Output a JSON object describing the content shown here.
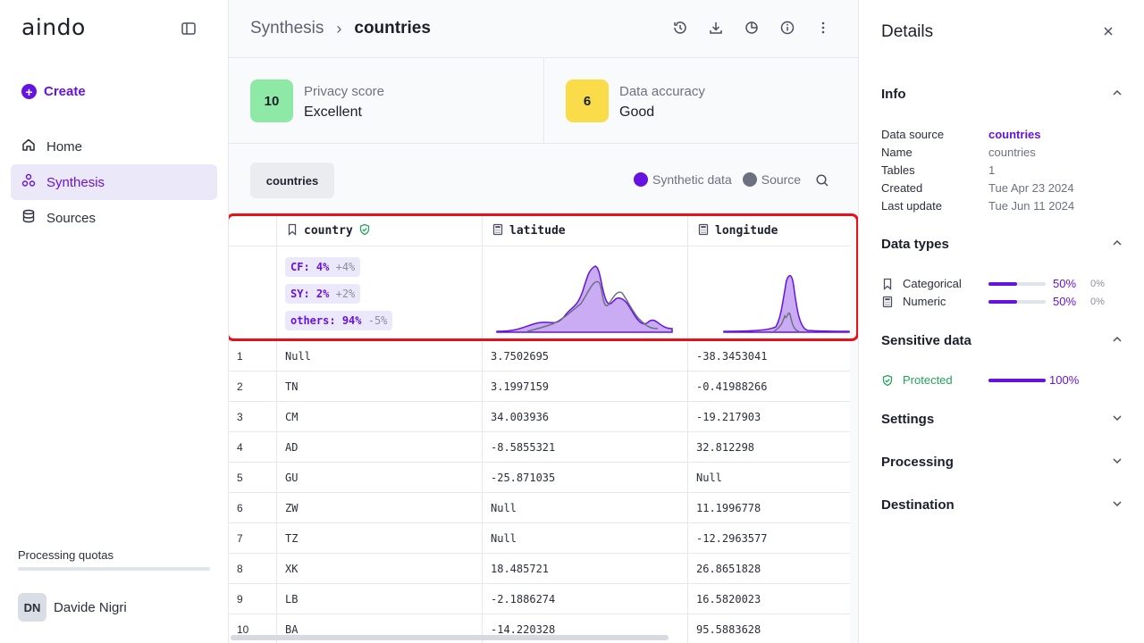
{
  "sidebar": {
    "logo": "aindo",
    "create_label": "Create",
    "nav": [
      {
        "label": "Home",
        "icon": "home-icon"
      },
      {
        "label": "Synthesis",
        "icon": "synthesis-icon"
      },
      {
        "label": "Sources",
        "icon": "database-icon"
      }
    ],
    "quota_label": "Processing quotas",
    "user": {
      "initials": "DN",
      "name": "Davide Nigri"
    }
  },
  "header": {
    "breadcrumb_parent": "Synthesis",
    "breadcrumb_current": "countries",
    "toolbar_icons": [
      "history-icon",
      "download-icon",
      "pie-chart-icon",
      "info-icon",
      "more-vertical-icon"
    ]
  },
  "scores": [
    {
      "badge": "10",
      "title": "Privacy score",
      "value": "Excellent",
      "color": "#8ee8a6"
    },
    {
      "badge": "6",
      "title": "Data accuracy",
      "value": "Good",
      "color": "#fadb4a"
    }
  ],
  "table": {
    "tab_label": "countries",
    "legend": {
      "synthetic": "Synthetic data",
      "source": "Source",
      "synthetic_color": "#6612e3",
      "source_color": "#6b7180"
    },
    "columns": [
      {
        "name": "country",
        "type": "categorical",
        "protected": true
      },
      {
        "name": "latitude",
        "type": "numeric"
      },
      {
        "name": "longitude",
        "type": "numeric"
      }
    ],
    "country_summary": [
      {
        "label": "CF:",
        "value": "4%",
        "delta": "+4%"
      },
      {
        "label": "SY:",
        "value": "2%",
        "delta": "+2%"
      },
      {
        "label": "others:",
        "value": "94%",
        "delta": "-5%"
      }
    ],
    "rows": [
      {
        "n": "1",
        "country": "Null",
        "latitude": "3.7502695",
        "longitude": "-38.3453041"
      },
      {
        "n": "2",
        "country": "TN",
        "latitude": "3.1997159",
        "longitude": "-0.41988266"
      },
      {
        "n": "3",
        "country": "CM",
        "latitude": "34.003936",
        "longitude": "-19.217903"
      },
      {
        "n": "4",
        "country": "AD",
        "latitude": "-8.5855321",
        "longitude": "32.812298"
      },
      {
        "n": "5",
        "country": "GU",
        "latitude": "-25.871035",
        "longitude": "Null"
      },
      {
        "n": "6",
        "country": "ZW",
        "latitude": "Null",
        "longitude": "11.1996778"
      },
      {
        "n": "7",
        "country": "TZ",
        "latitude": "Null",
        "longitude": "-12.2963577"
      },
      {
        "n": "8",
        "country": "XK",
        "latitude": "18.485721",
        "longitude": "26.8651828"
      },
      {
        "n": "9",
        "country": "LB",
        "latitude": "-2.1886274",
        "longitude": "16.5820023"
      },
      {
        "n": "10",
        "country": "BA",
        "latitude": "-14.220328",
        "longitude": "95.5883628"
      }
    ]
  },
  "details": {
    "title": "Details",
    "info": {
      "heading": "Info",
      "items": [
        {
          "k": "Data source",
          "v": "countries"
        },
        {
          "k": "Name",
          "v": "countries"
        },
        {
          "k": "Tables",
          "v": "1"
        },
        {
          "k": "Created",
          "v": "Tue Apr 23 2024"
        },
        {
          "k": "Last update",
          "v": "Tue Jun 11 2024"
        }
      ]
    },
    "data_types": {
      "heading": "Data types",
      "items": [
        {
          "label": "Categorical",
          "pct": "50%",
          "pct2": "0%",
          "fill": 0.5
        },
        {
          "label": "Numeric",
          "pct": "50%",
          "pct2": "0%",
          "fill": 0.5
        }
      ]
    },
    "sensitive": {
      "heading": "Sensitive data",
      "label": "Protected",
      "pct": "100%",
      "fill": 1.0
    },
    "collapsed_sections": [
      "Settings",
      "Processing",
      "Destination"
    ]
  }
}
